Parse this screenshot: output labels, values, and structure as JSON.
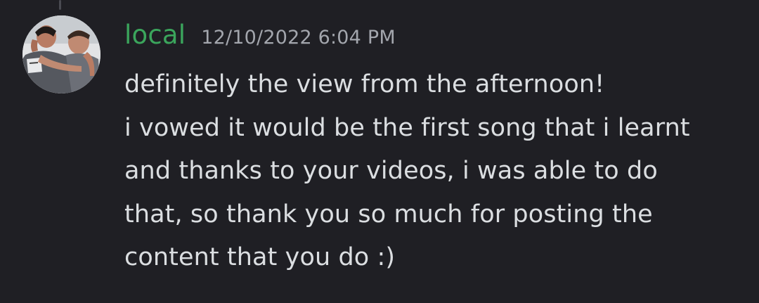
{
  "message": {
    "author": "local",
    "timestamp": "12/10/2022 6:04 PM",
    "avatar_icon": "user-avatar-photo",
    "username_color": "#3ba55c",
    "lines": [
      "definitely the view from the afternoon!",
      "i vowed it would be the first song that i learnt",
      "and thanks to your videos, i was able to do",
      "that, so thank you so much for posting the",
      "content that you do :)"
    ]
  }
}
